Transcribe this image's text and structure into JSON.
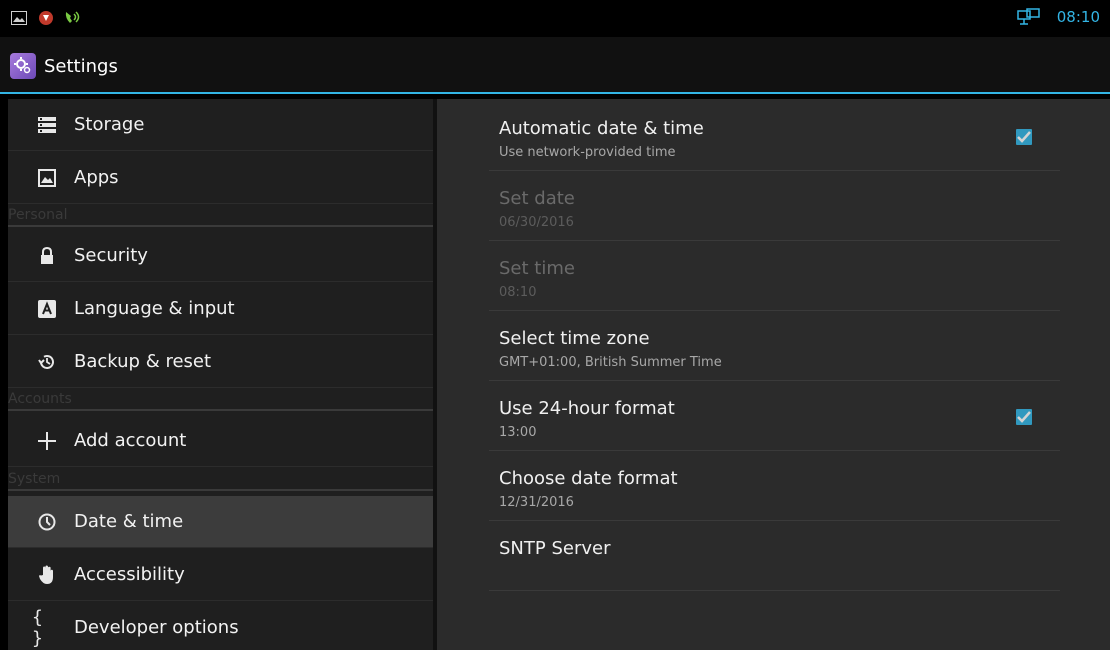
{
  "status_bar": {
    "icons_left": [
      "gallery-icon",
      "record-icon",
      "call-icon"
    ],
    "icons_right": [
      "network-icon"
    ],
    "time": "08:10"
  },
  "action_bar": {
    "app_icon": "settings-gear-icon",
    "title": "Settings"
  },
  "sidebar": {
    "items": [
      {
        "label": "Storage",
        "icon": "storage-icon"
      },
      {
        "label": "Apps",
        "icon": "apps-icon"
      },
      {
        "label": "Security",
        "icon": "lock-icon"
      },
      {
        "label": "Language & input",
        "icon": "keyboard-icon"
      },
      {
        "label": "Backup & reset",
        "icon": "backup-icon"
      },
      {
        "label": "Add account",
        "icon": "plus-icon"
      },
      {
        "label": "Date & time",
        "icon": "clock-icon",
        "selected": true
      },
      {
        "label": "Accessibility",
        "icon": "hand-icon"
      },
      {
        "label": "Developer options",
        "icon": "braces-icon"
      }
    ],
    "sections": [
      "Personal",
      "Accounts",
      "System"
    ]
  },
  "preferences": [
    {
      "title": "Automatic date & time",
      "summary": "Use network-provided time",
      "checked": true,
      "enabled": true
    },
    {
      "title": "Set date",
      "summary": "06/30/2016",
      "enabled": false
    },
    {
      "title": "Set time",
      "summary": "08:10",
      "enabled": false
    },
    {
      "title": "Select time zone",
      "summary": "GMT+01:00, British Summer Time",
      "enabled": true
    },
    {
      "title": "Use 24-hour format",
      "summary": "13:00",
      "checked": true,
      "enabled": true
    },
    {
      "title": "Choose date format",
      "summary": "12/31/2016",
      "enabled": true
    },
    {
      "title": "SNTP Server",
      "summary": "",
      "enabled": true
    }
  ],
  "colors": {
    "accent": "#33b5e5",
    "background": "#000000",
    "left_pane": "#1f1f1f",
    "right_pane": "#2b2b2b",
    "selected_row": "#3c3c3c"
  }
}
